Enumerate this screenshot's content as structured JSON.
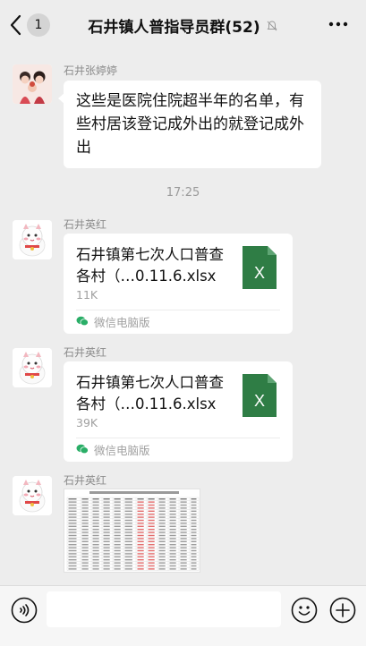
{
  "header": {
    "back_count": "1",
    "title": "石井镇人普指导员群(52)"
  },
  "messages": [
    {
      "sender": "石井张婷婷",
      "text": "这些是医院住院超半年的名单，有些村居该登记成外出的就登记成外出"
    },
    {
      "time": "17:25"
    },
    {
      "sender": "石井英红",
      "file": {
        "name": "石井镇第七次人口普查各村（…0.11.6.xlsx",
        "size": "11K",
        "source": "微信电脑版",
        "icon": "excel-file-icon",
        "icon_letter": "X",
        "icon_color": "#2f7d45"
      }
    },
    {
      "sender": "石井英红",
      "file": {
        "name": "石井镇第七次人口普查各村（…0.11.6.xlsx",
        "size": "39K",
        "source": "微信电脑版",
        "icon": "excel-file-icon",
        "icon_letter": "X",
        "icon_color": "#2f7d45"
      }
    },
    {
      "sender": "石井英红",
      "image": "spreadsheet-thumbnail"
    }
  ],
  "colors": {
    "background": "#ededed",
    "bubble": "#ffffff",
    "excel_green": "#2f7d45",
    "wechat_green": "#2aae67"
  }
}
